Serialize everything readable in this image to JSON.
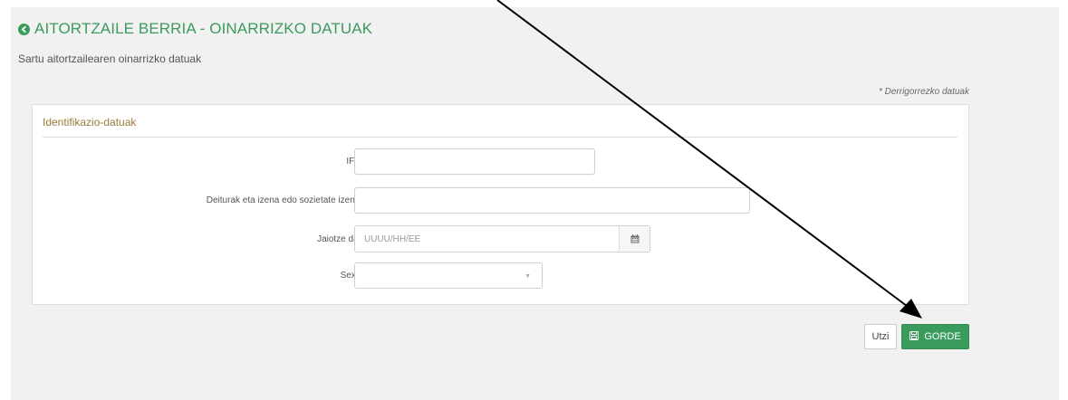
{
  "header": {
    "title": "AITORTZAILE BERRIA - OINARRIZKO DATUAK",
    "subtitle": "Sartu aitortzailearen oinarrizko datuak",
    "required_note": "* Derrigorrezko datuak"
  },
  "card": {
    "title": "Identifikazio-datuak",
    "fields": {
      "ifz": {
        "label": "IFZ *",
        "value": ""
      },
      "name": {
        "label": "Deiturak eta izena edo sozietate izena *",
        "value": ""
      },
      "birthdate": {
        "label": "Jaiotze data",
        "placeholder": "UUUU/HH/EE"
      },
      "sex": {
        "label": "Sexua",
        "value": ""
      }
    }
  },
  "actions": {
    "cancel_label": "Utzi",
    "save_label": "GORDE"
  },
  "colors": {
    "accent": "#3a9b5c",
    "section_title": "#9a7a3a"
  },
  "icons": {
    "title": "back-circle-icon",
    "date": "calendar-icon",
    "select": "caret-down-icon",
    "save": "floppy-disk-icon"
  }
}
